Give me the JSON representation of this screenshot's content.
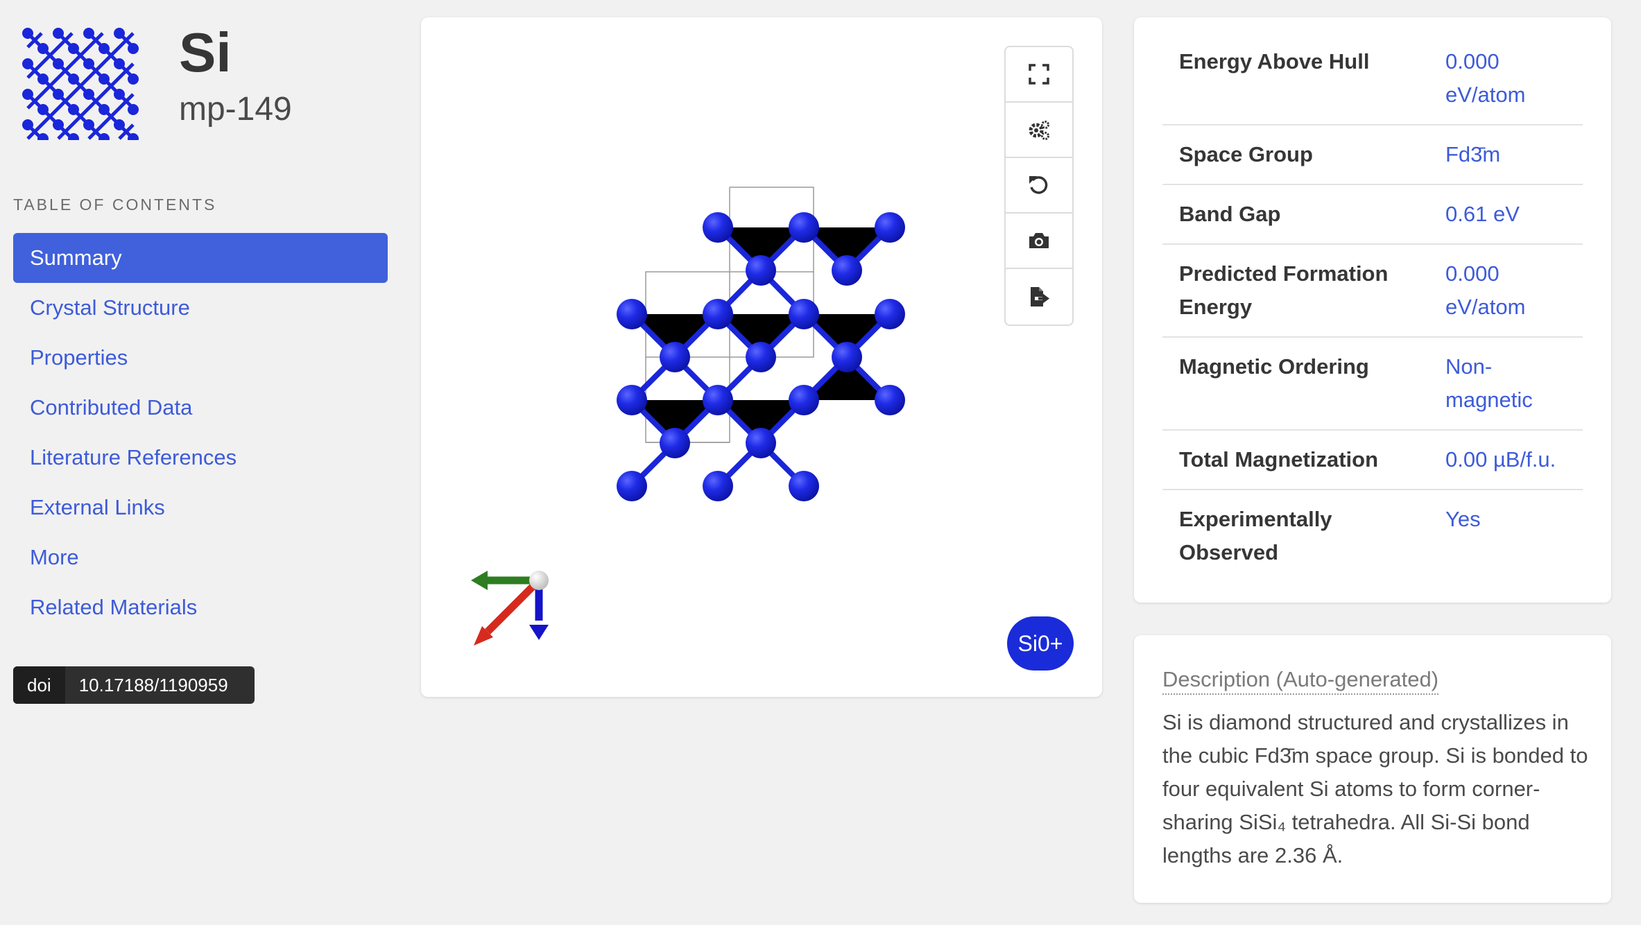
{
  "header": {
    "formula": "Si",
    "material_id": "mp-149"
  },
  "icons": {
    "logo": "crystal-lattice-icon",
    "fullscreen": "expand-icon",
    "settings": "gears-icon",
    "reset": "rotate-left-icon",
    "screenshot": "camera-icon",
    "export": "file-export-icon"
  },
  "toc": {
    "heading": "TABLE OF CONTENTS",
    "items": [
      {
        "label": "Summary",
        "active": true
      },
      {
        "label": "Crystal Structure",
        "active": false
      },
      {
        "label": "Properties",
        "active": false
      },
      {
        "label": "Contributed Data",
        "active": false
      },
      {
        "label": "Literature References",
        "active": false
      },
      {
        "label": "External Links",
        "active": false
      },
      {
        "label": "More",
        "active": false
      },
      {
        "label": "Related Materials",
        "active": false
      }
    ]
  },
  "doi": {
    "key": "doi",
    "value": "10.17188/1190959"
  },
  "viewer": {
    "species_label": "Si0+",
    "atom_color": "#1a26e6",
    "axis_colors": {
      "a": "#d62a1e",
      "b": "#2e7d22",
      "c": "#1414c8"
    }
  },
  "properties": [
    {
      "key": "Energy Above Hull",
      "value": "0.000 eV/atom"
    },
    {
      "key": "Space Group",
      "value": "Fd3̄m"
    },
    {
      "key": "Band Gap",
      "value": "0.61 eV"
    },
    {
      "key": "Predicted Formation Energy",
      "value": "0.000 eV/atom"
    },
    {
      "key": "Magnetic Ordering",
      "value": "Non-magnetic"
    },
    {
      "key": "Total Magnetization",
      "value": "0.00 µB/f.u."
    },
    {
      "key": "Experimentally Observed",
      "value": "Yes"
    }
  ],
  "description": {
    "title": "Description (Auto-generated)",
    "text": "Si is diamond structured and crystallizes in the cubic Fd3̄m space group. Si is bonded to four equivalent Si atoms to form corner-sharing SiSi₄ tetrahedra. All Si-Si bond lengths are 2.36 Å."
  },
  "colors": {
    "accent": "#4061db",
    "link": "#3d5bd9"
  }
}
